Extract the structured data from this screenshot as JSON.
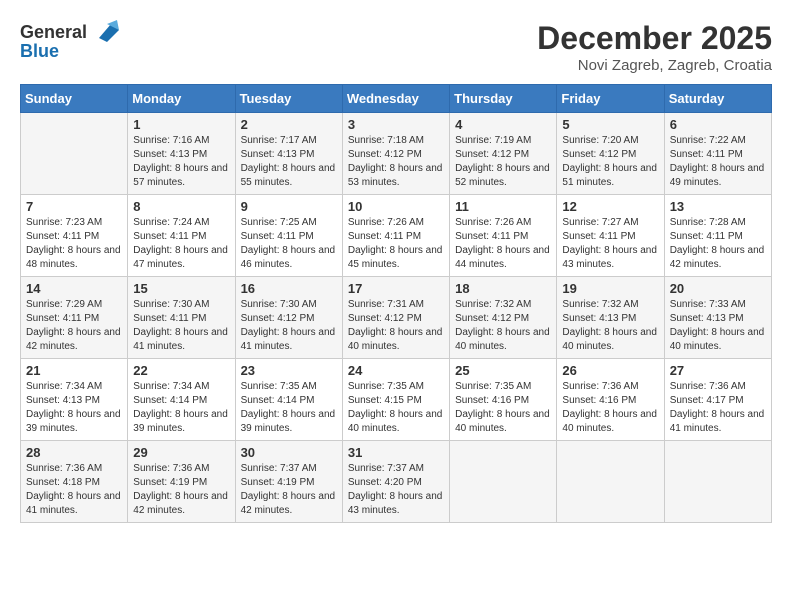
{
  "header": {
    "logo_general": "General",
    "logo_blue": "Blue",
    "title": "December 2025",
    "subtitle": "Novi Zagreb, Zagreb, Croatia"
  },
  "calendar": {
    "weekdays": [
      "Sunday",
      "Monday",
      "Tuesday",
      "Wednesday",
      "Thursday",
      "Friday",
      "Saturday"
    ],
    "weeks": [
      [
        {
          "day": "",
          "sunrise": "",
          "sunset": "",
          "daylight": ""
        },
        {
          "day": "1",
          "sunrise": "Sunrise: 7:16 AM",
          "sunset": "Sunset: 4:13 PM",
          "daylight": "Daylight: 8 hours and 57 minutes."
        },
        {
          "day": "2",
          "sunrise": "Sunrise: 7:17 AM",
          "sunset": "Sunset: 4:13 PM",
          "daylight": "Daylight: 8 hours and 55 minutes."
        },
        {
          "day": "3",
          "sunrise": "Sunrise: 7:18 AM",
          "sunset": "Sunset: 4:12 PM",
          "daylight": "Daylight: 8 hours and 53 minutes."
        },
        {
          "day": "4",
          "sunrise": "Sunrise: 7:19 AM",
          "sunset": "Sunset: 4:12 PM",
          "daylight": "Daylight: 8 hours and 52 minutes."
        },
        {
          "day": "5",
          "sunrise": "Sunrise: 7:20 AM",
          "sunset": "Sunset: 4:12 PM",
          "daylight": "Daylight: 8 hours and 51 minutes."
        },
        {
          "day": "6",
          "sunrise": "Sunrise: 7:22 AM",
          "sunset": "Sunset: 4:11 PM",
          "daylight": "Daylight: 8 hours and 49 minutes."
        }
      ],
      [
        {
          "day": "7",
          "sunrise": "Sunrise: 7:23 AM",
          "sunset": "Sunset: 4:11 PM",
          "daylight": "Daylight: 8 hours and 48 minutes."
        },
        {
          "day": "8",
          "sunrise": "Sunrise: 7:24 AM",
          "sunset": "Sunset: 4:11 PM",
          "daylight": "Daylight: 8 hours and 47 minutes."
        },
        {
          "day": "9",
          "sunrise": "Sunrise: 7:25 AM",
          "sunset": "Sunset: 4:11 PM",
          "daylight": "Daylight: 8 hours and 46 minutes."
        },
        {
          "day": "10",
          "sunrise": "Sunrise: 7:26 AM",
          "sunset": "Sunset: 4:11 PM",
          "daylight": "Daylight: 8 hours and 45 minutes."
        },
        {
          "day": "11",
          "sunrise": "Sunrise: 7:26 AM",
          "sunset": "Sunset: 4:11 PM",
          "daylight": "Daylight: 8 hours and 44 minutes."
        },
        {
          "day": "12",
          "sunrise": "Sunrise: 7:27 AM",
          "sunset": "Sunset: 4:11 PM",
          "daylight": "Daylight: 8 hours and 43 minutes."
        },
        {
          "day": "13",
          "sunrise": "Sunrise: 7:28 AM",
          "sunset": "Sunset: 4:11 PM",
          "daylight": "Daylight: 8 hours and 42 minutes."
        }
      ],
      [
        {
          "day": "14",
          "sunrise": "Sunrise: 7:29 AM",
          "sunset": "Sunset: 4:11 PM",
          "daylight": "Daylight: 8 hours and 42 minutes."
        },
        {
          "day": "15",
          "sunrise": "Sunrise: 7:30 AM",
          "sunset": "Sunset: 4:11 PM",
          "daylight": "Daylight: 8 hours and 41 minutes."
        },
        {
          "day": "16",
          "sunrise": "Sunrise: 7:30 AM",
          "sunset": "Sunset: 4:12 PM",
          "daylight": "Daylight: 8 hours and 41 minutes."
        },
        {
          "day": "17",
          "sunrise": "Sunrise: 7:31 AM",
          "sunset": "Sunset: 4:12 PM",
          "daylight": "Daylight: 8 hours and 40 minutes."
        },
        {
          "day": "18",
          "sunrise": "Sunrise: 7:32 AM",
          "sunset": "Sunset: 4:12 PM",
          "daylight": "Daylight: 8 hours and 40 minutes."
        },
        {
          "day": "19",
          "sunrise": "Sunrise: 7:32 AM",
          "sunset": "Sunset: 4:13 PM",
          "daylight": "Daylight: 8 hours and 40 minutes."
        },
        {
          "day": "20",
          "sunrise": "Sunrise: 7:33 AM",
          "sunset": "Sunset: 4:13 PM",
          "daylight": "Daylight: 8 hours and 40 minutes."
        }
      ],
      [
        {
          "day": "21",
          "sunrise": "Sunrise: 7:34 AM",
          "sunset": "Sunset: 4:13 PM",
          "daylight": "Daylight: 8 hours and 39 minutes."
        },
        {
          "day": "22",
          "sunrise": "Sunrise: 7:34 AM",
          "sunset": "Sunset: 4:14 PM",
          "daylight": "Daylight: 8 hours and 39 minutes."
        },
        {
          "day": "23",
          "sunrise": "Sunrise: 7:35 AM",
          "sunset": "Sunset: 4:14 PM",
          "daylight": "Daylight: 8 hours and 39 minutes."
        },
        {
          "day": "24",
          "sunrise": "Sunrise: 7:35 AM",
          "sunset": "Sunset: 4:15 PM",
          "daylight": "Daylight: 8 hours and 40 minutes."
        },
        {
          "day": "25",
          "sunrise": "Sunrise: 7:35 AM",
          "sunset": "Sunset: 4:16 PM",
          "daylight": "Daylight: 8 hours and 40 minutes."
        },
        {
          "day": "26",
          "sunrise": "Sunrise: 7:36 AM",
          "sunset": "Sunset: 4:16 PM",
          "daylight": "Daylight: 8 hours and 40 minutes."
        },
        {
          "day": "27",
          "sunrise": "Sunrise: 7:36 AM",
          "sunset": "Sunset: 4:17 PM",
          "daylight": "Daylight: 8 hours and 41 minutes."
        }
      ],
      [
        {
          "day": "28",
          "sunrise": "Sunrise: 7:36 AM",
          "sunset": "Sunset: 4:18 PM",
          "daylight": "Daylight: 8 hours and 41 minutes."
        },
        {
          "day": "29",
          "sunrise": "Sunrise: 7:36 AM",
          "sunset": "Sunset: 4:19 PM",
          "daylight": "Daylight: 8 hours and 42 minutes."
        },
        {
          "day": "30",
          "sunrise": "Sunrise: 7:37 AM",
          "sunset": "Sunset: 4:19 PM",
          "daylight": "Daylight: 8 hours and 42 minutes."
        },
        {
          "day": "31",
          "sunrise": "Sunrise: 7:37 AM",
          "sunset": "Sunset: 4:20 PM",
          "daylight": "Daylight: 8 hours and 43 minutes."
        },
        {
          "day": "",
          "sunrise": "",
          "sunset": "",
          "daylight": ""
        },
        {
          "day": "",
          "sunrise": "",
          "sunset": "",
          "daylight": ""
        },
        {
          "day": "",
          "sunrise": "",
          "sunset": "",
          "daylight": ""
        }
      ]
    ]
  }
}
